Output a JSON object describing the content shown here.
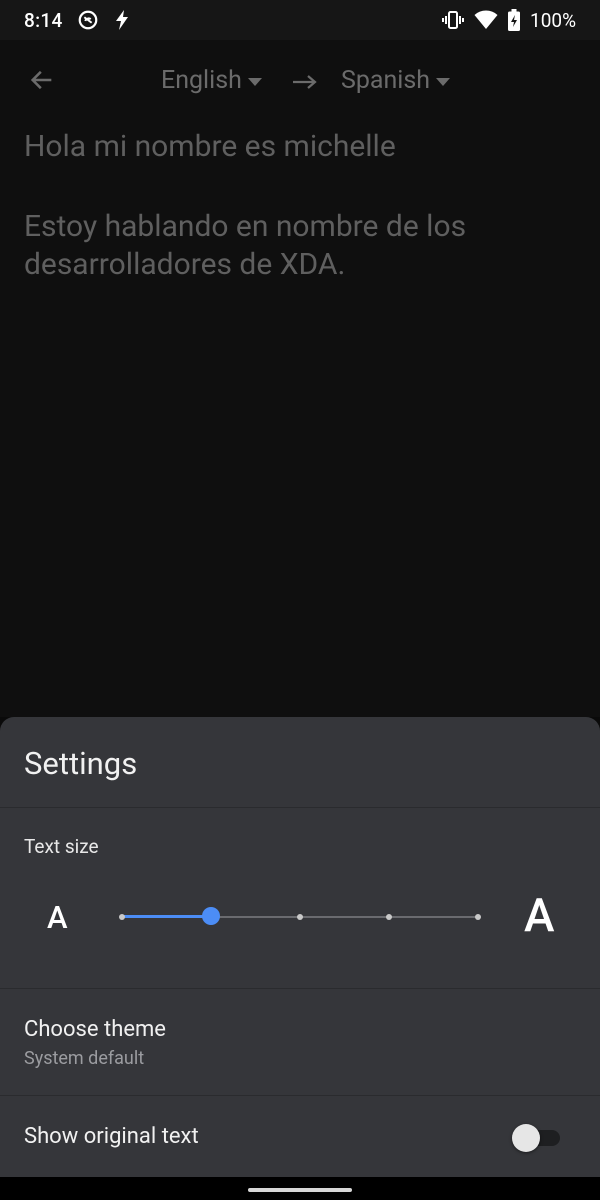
{
  "status_bar": {
    "time": "8:14",
    "battery": "100%",
    "icons": [
      "do-not-disturb-icon",
      "flash-icon",
      "vibrate-icon",
      "wifi-icon",
      "battery-charging-icon"
    ]
  },
  "toolbar": {
    "back_icon": "arrow-left-icon",
    "from_language": "English",
    "to_language": "Spanish",
    "arrow_icon": "arrow-right-icon"
  },
  "translated_text": {
    "paragraphs": [
      "Hola mi nombre es michelle",
      "Estoy hablando en nombre de los desarrolladores de XDA."
    ]
  },
  "settings": {
    "title": "Settings",
    "text_size": {
      "label": "Text size",
      "small_glyph": "A",
      "large_glyph": "A",
      "steps": 5,
      "selected_step": 2,
      "accent_color": "#4c8df6"
    },
    "choose_theme": {
      "title": "Choose theme",
      "value": "System default"
    },
    "show_original_text": {
      "title": "Show original text",
      "enabled": false
    }
  }
}
